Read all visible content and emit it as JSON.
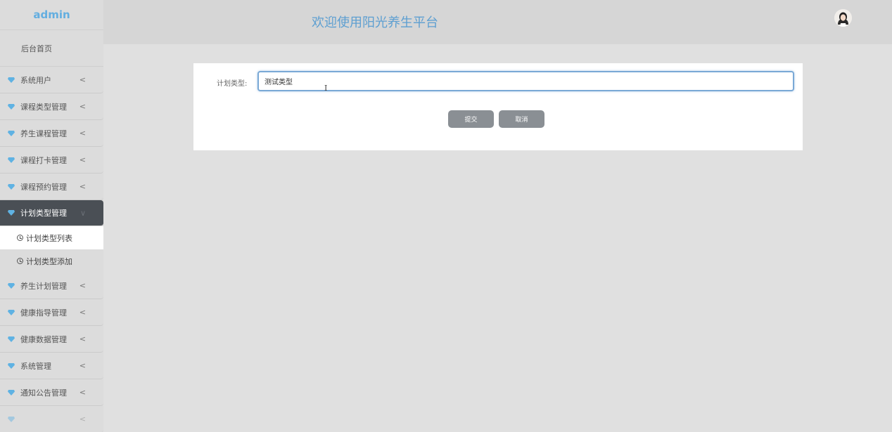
{
  "sidebar": {
    "brand": "admin",
    "home": "后台首页",
    "items": [
      {
        "label": "系统用户"
      },
      {
        "label": "课程类型管理"
      },
      {
        "label": "养生课程管理"
      },
      {
        "label": "课程打卡管理"
      },
      {
        "label": "课程预约管理"
      },
      {
        "label": "计划类型管理"
      },
      {
        "label": "养生计划管理"
      },
      {
        "label": "健康指导管理"
      },
      {
        "label": "健康数据管理"
      },
      {
        "label": "系统管理"
      },
      {
        "label": "通知公告管理"
      }
    ],
    "sub_items": [
      {
        "label": "计划类型列表"
      },
      {
        "label": "计划类型添加"
      }
    ],
    "chevron": "<",
    "expanded_chevron": "∨"
  },
  "header": {
    "title": "欢迎使用阳光养生平台"
  },
  "form": {
    "label": "计划类型:",
    "value": "测试类型",
    "submit_label": "提交",
    "cancel_label": "取消"
  },
  "colors": {
    "accent": "#5d9fd1",
    "brand": "#63aee0",
    "active_menu": "#4a4f55",
    "button": "#8a8f94"
  }
}
